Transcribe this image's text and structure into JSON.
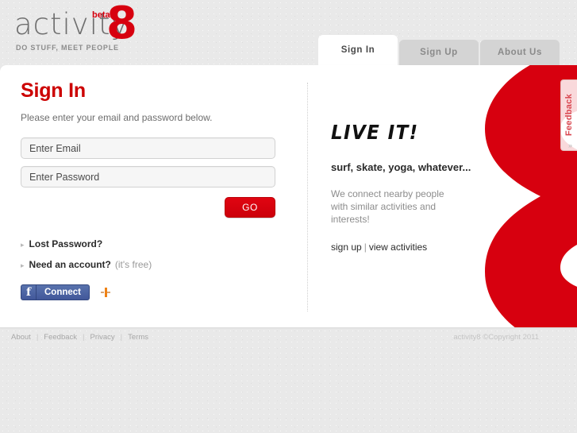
{
  "brand": {
    "name": "activity",
    "mark": "8",
    "badge": "beta",
    "tagline": "DO STUFF, MEET PEOPLE"
  },
  "tabs": [
    {
      "label": "Sign In",
      "active": true
    },
    {
      "label": "Sign Up",
      "active": false
    },
    {
      "label": "About Us",
      "active": false
    }
  ],
  "signin": {
    "title": "Sign In",
    "subtitle": "Please enter your email and password below.",
    "email_placeholder": "Enter Email",
    "email_value": "",
    "password_placeholder": "Enter Password",
    "password_value": "",
    "submit_label": "GO",
    "lost_password": "Lost Password?",
    "need_account": "Need an account?",
    "need_account_note": "(it's free)",
    "facebook_label": "Connect"
  },
  "promo": {
    "headline": "LIVE IT!",
    "subhead": "surf, skate, yoga, whatever...",
    "body": "We connect nearby people with similar activities and interests!",
    "link_signup": "sign up",
    "link_separator": "|",
    "link_activities": "view activities"
  },
  "feedback": {
    "label": "Feedback",
    "arrow": "»"
  },
  "footer": {
    "links": [
      "About",
      "Feedback",
      "Privacy",
      "Terms"
    ],
    "separator": "|",
    "copyright": "activity8 ©Copyright 2011"
  },
  "colors": {
    "brand_red": "#d7000f",
    "title_red": "#cc0000",
    "facebook_blue": "#4c66a4",
    "page_bg": "#e9e9e9"
  }
}
